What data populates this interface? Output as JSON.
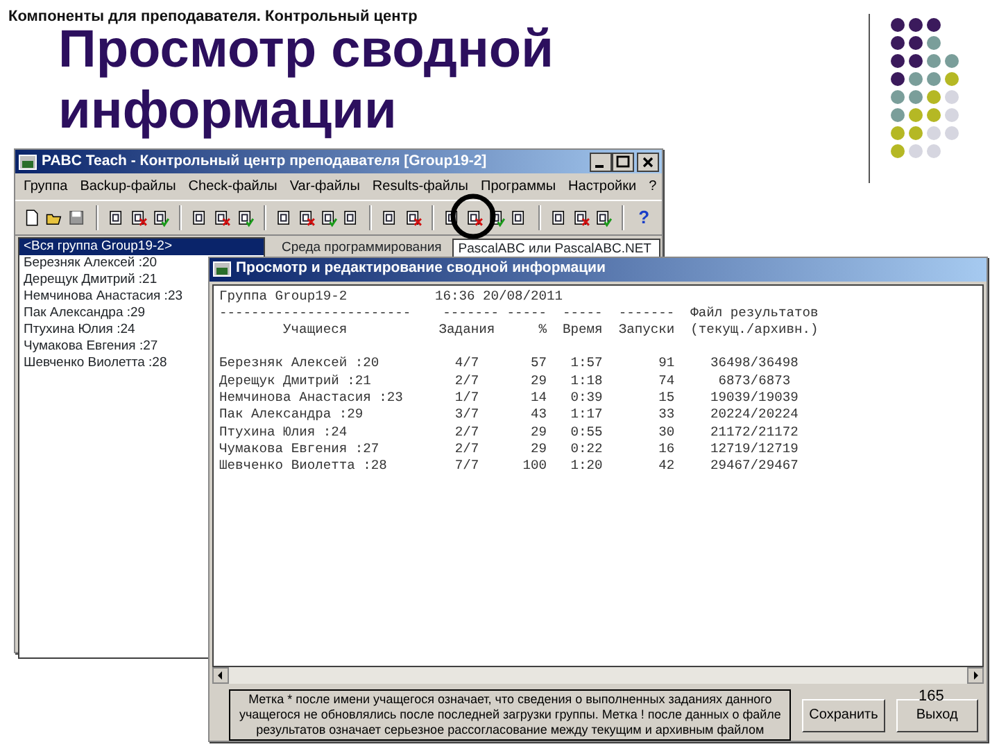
{
  "slide": {
    "header": "Компоненты для преподавателя. Контрольный центр",
    "title": "Просмотр сводной информации",
    "page_number": "165"
  },
  "main_window": {
    "title": "PABC Teach - Контрольный центр преподавателя [Group19-2]",
    "help_button": "?",
    "menu": [
      "Группа",
      "Backup-файлы",
      "Check-файлы",
      "Var-файлы",
      "Results-файлы",
      "Программы",
      "Настройки",
      "?"
    ],
    "students": [
      {
        "label": "<Вся группа Group19-2>",
        "selected": true
      },
      {
        "label": "Березняк Алексей :20",
        "selected": false
      },
      {
        "label": "Дерещук Дмитрий :21",
        "selected": false
      },
      {
        "label": "Немчинова Анастасия :23",
        "selected": false
      },
      {
        "label": "Пак Александра :29",
        "selected": false
      },
      {
        "label": "Птухина Юлия :24",
        "selected": false
      },
      {
        "label": "Чумакова Евгения :27",
        "selected": false
      },
      {
        "label": "Шевченко Виолетта :28",
        "selected": false
      }
    ],
    "env_label": "Среда программирования",
    "env_value": "PascalABC или PascalABC.NET"
  },
  "summary_window": {
    "title": "Просмотр и редактирование сводной информации",
    "group": "Группа Group19-2",
    "datetime": "16:36 20/08/2011",
    "dashes": [
      "------------------------",
      "-------",
      "-----",
      "-----",
      "-------"
    ],
    "file_header": "Файл результатов",
    "columns": [
      "Учащиеся",
      "Задания",
      "%",
      "Время",
      "Запуски",
      "(текущ./архивн.)"
    ],
    "rows": [
      [
        "Березняк Алексей :20",
        "4/7",
        "57",
        "1:57",
        "91",
        "36498/36498"
      ],
      [
        "Дерещук Дмитрий :21",
        "2/7",
        "29",
        "1:18",
        "74",
        "6873/6873"
      ],
      [
        "Немчинова Анастасия :23",
        "1/7",
        "14",
        "0:39",
        "15",
        "19039/19039"
      ],
      [
        "Пак Александра :29",
        "3/7",
        "43",
        "1:17",
        "33",
        "20224/20224"
      ],
      [
        "Птухина Юлия :24",
        "2/7",
        "29",
        "0:55",
        "30",
        "21172/21172"
      ],
      [
        "Чумакова Евгения :27",
        "2/7",
        "29",
        "0:22",
        "16",
        "12719/12719"
      ],
      [
        "Шевченко Виолетта :28",
        "7/7",
        "100",
        "1:20",
        "42",
        "29467/29467"
      ]
    ],
    "note": "Метка * после имени учащегося означает, что сведения о выполненных заданиях данного учащегося не обновлялись после последней загрузки группы. Метка ! после данных о файле результатов означает серьезное рассогласование между текущим и архивным файлом",
    "buttons": [
      "Сохранить",
      "Выход"
    ]
  }
}
